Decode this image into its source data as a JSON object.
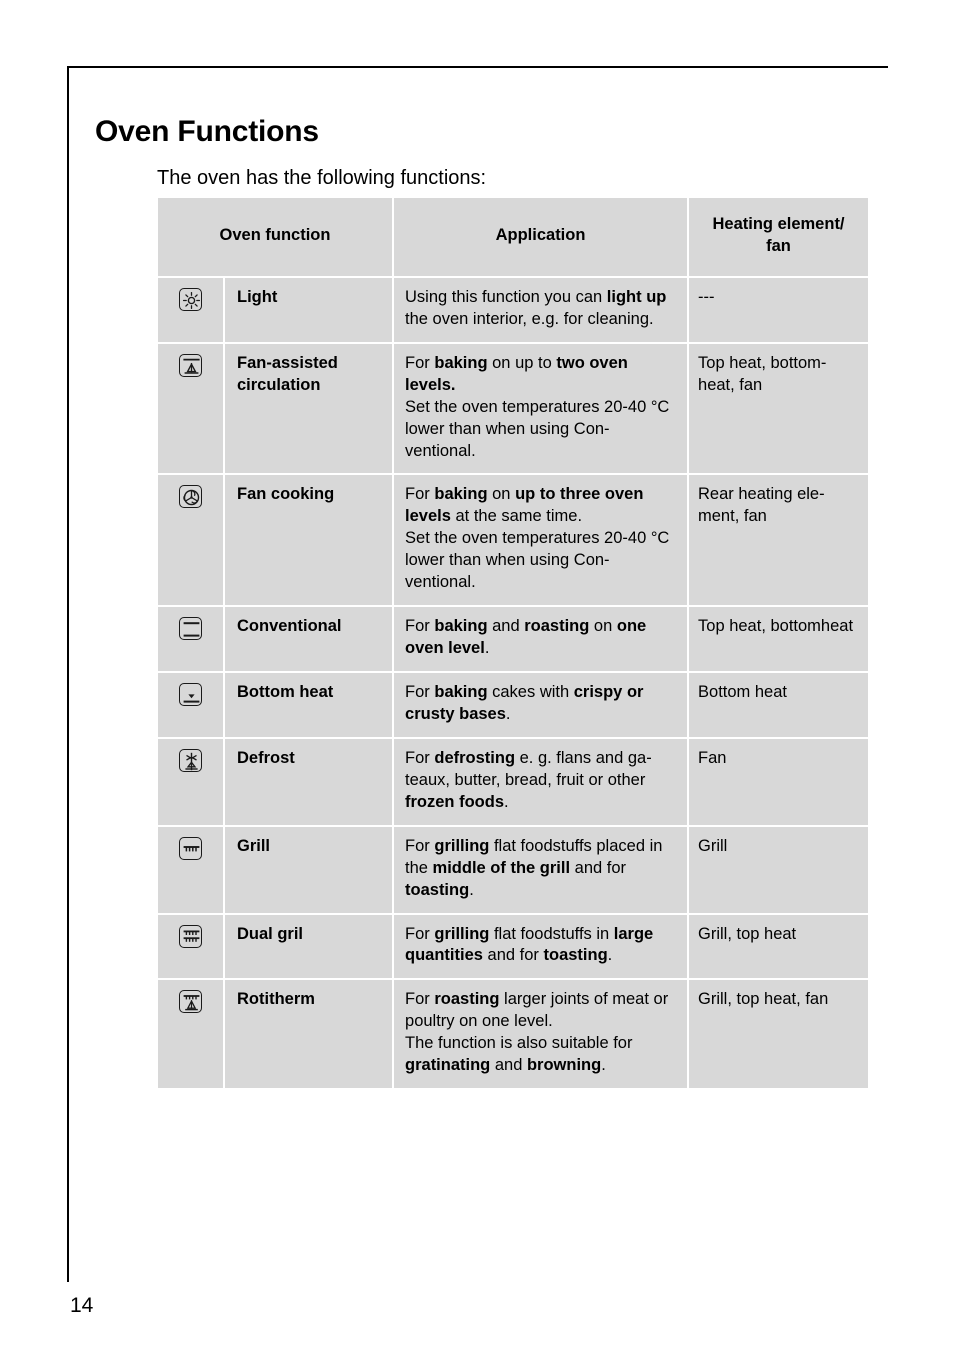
{
  "page": {
    "title": "Oven Functions",
    "intro": "The oven has the following functions:",
    "number": "14",
    "accent_color": "#d8d8d8",
    "text_color": "#000000"
  },
  "table": {
    "headers": {
      "function": "Oven function",
      "application": "Application",
      "heating": "Heating element/\nfan",
      "heating_line1": "Heating element/",
      "heating_line2": "fan"
    },
    "rows": [
      {
        "icon": "oven-light-icon",
        "name": "Light",
        "application_html": "Using this function you can <b>light up</b> the oven interior, e.g. for cleaning.",
        "heating": "---"
      },
      {
        "icon": "fan-assisted-circulation-icon",
        "name": "Fan-assisted circulation",
        "application_html": "For <b>baking</b> on up to <b>two oven levels.</b><br>Set the oven temperatures 20-40 °C lower than when using Con-ventional.",
        "heating": "Top heat, bottom-heat, fan"
      },
      {
        "icon": "fan-cooking-icon",
        "name": "Fan cooking",
        "application_html": "For <b>baking</b> on <b>up to three oven levels</b> at the same time.<br>Set the oven temperatures 20-40 °C lower than when using Con-ventional.",
        "heating": "Rear heating ele-ment, fan"
      },
      {
        "icon": "conventional-icon",
        "name": "Conventional",
        "application_html": "For <b>baking</b> and <b>roasting</b> on <b>one oven level</b>.",
        "heating": "Top heat, bottomheat"
      },
      {
        "icon": "bottom-heat-icon",
        "name": "Bottom heat",
        "application_html": "For <b>baking</b> cakes with <b>crispy or crusty bases</b>.",
        "heating": "Bottom heat"
      },
      {
        "icon": "defrost-icon",
        "name": "Defrost",
        "application_html": "For <b>defrosting</b> e. g. flans and ga-teaux, butter, bread, fruit or other <b>frozen foods</b>.",
        "heating": "Fan"
      },
      {
        "icon": "grill-icon",
        "name": "Grill",
        "application_html": "For <b>grilling</b> flat foodstuffs placed in the <b>middle of the grill</b> and for <b>toasting</b>.",
        "heating": "Grill"
      },
      {
        "icon": "dual-grill-icon",
        "name": "Dual gril",
        "application_html": "For <b>grilling</b> flat foodstuffs in <b>large quantities</b> and for <b>toasting</b>.",
        "heating": "Grill, top heat"
      },
      {
        "icon": "rotitherm-icon",
        "name": "Rotitherm",
        "application_html": "For <b>roasting</b> larger joints of meat or poultry on one level.<br>The function is also suitable for <b>gratinating</b> and <b>browning</b>.",
        "heating": "Grill, top heat, fan"
      }
    ]
  }
}
